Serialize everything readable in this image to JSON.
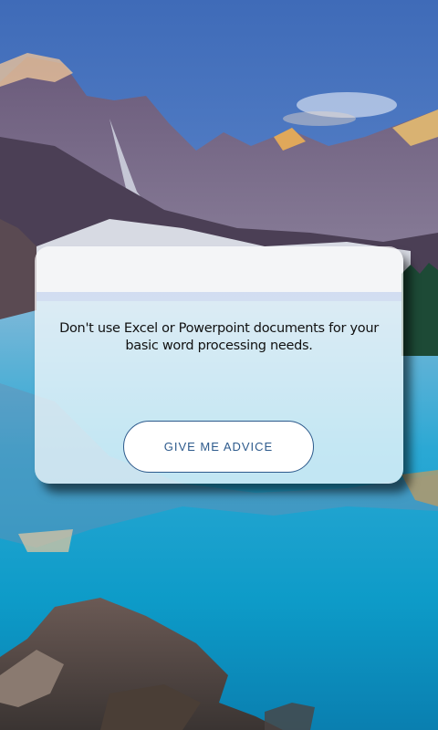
{
  "advice_card": {
    "text": "Don't use Excel or Powerpoint documents for your basic word processing needs."
  },
  "give_advice_button": {
    "label": "GIVE ME ADVICE"
  },
  "background": {
    "description_icon": "mountain-lake-photo",
    "colors": {
      "sky": "#4f7cc3",
      "mountains": "#5b4e70",
      "water": "#12a7cf",
      "button_accent": "#2d5a8c"
    }
  }
}
